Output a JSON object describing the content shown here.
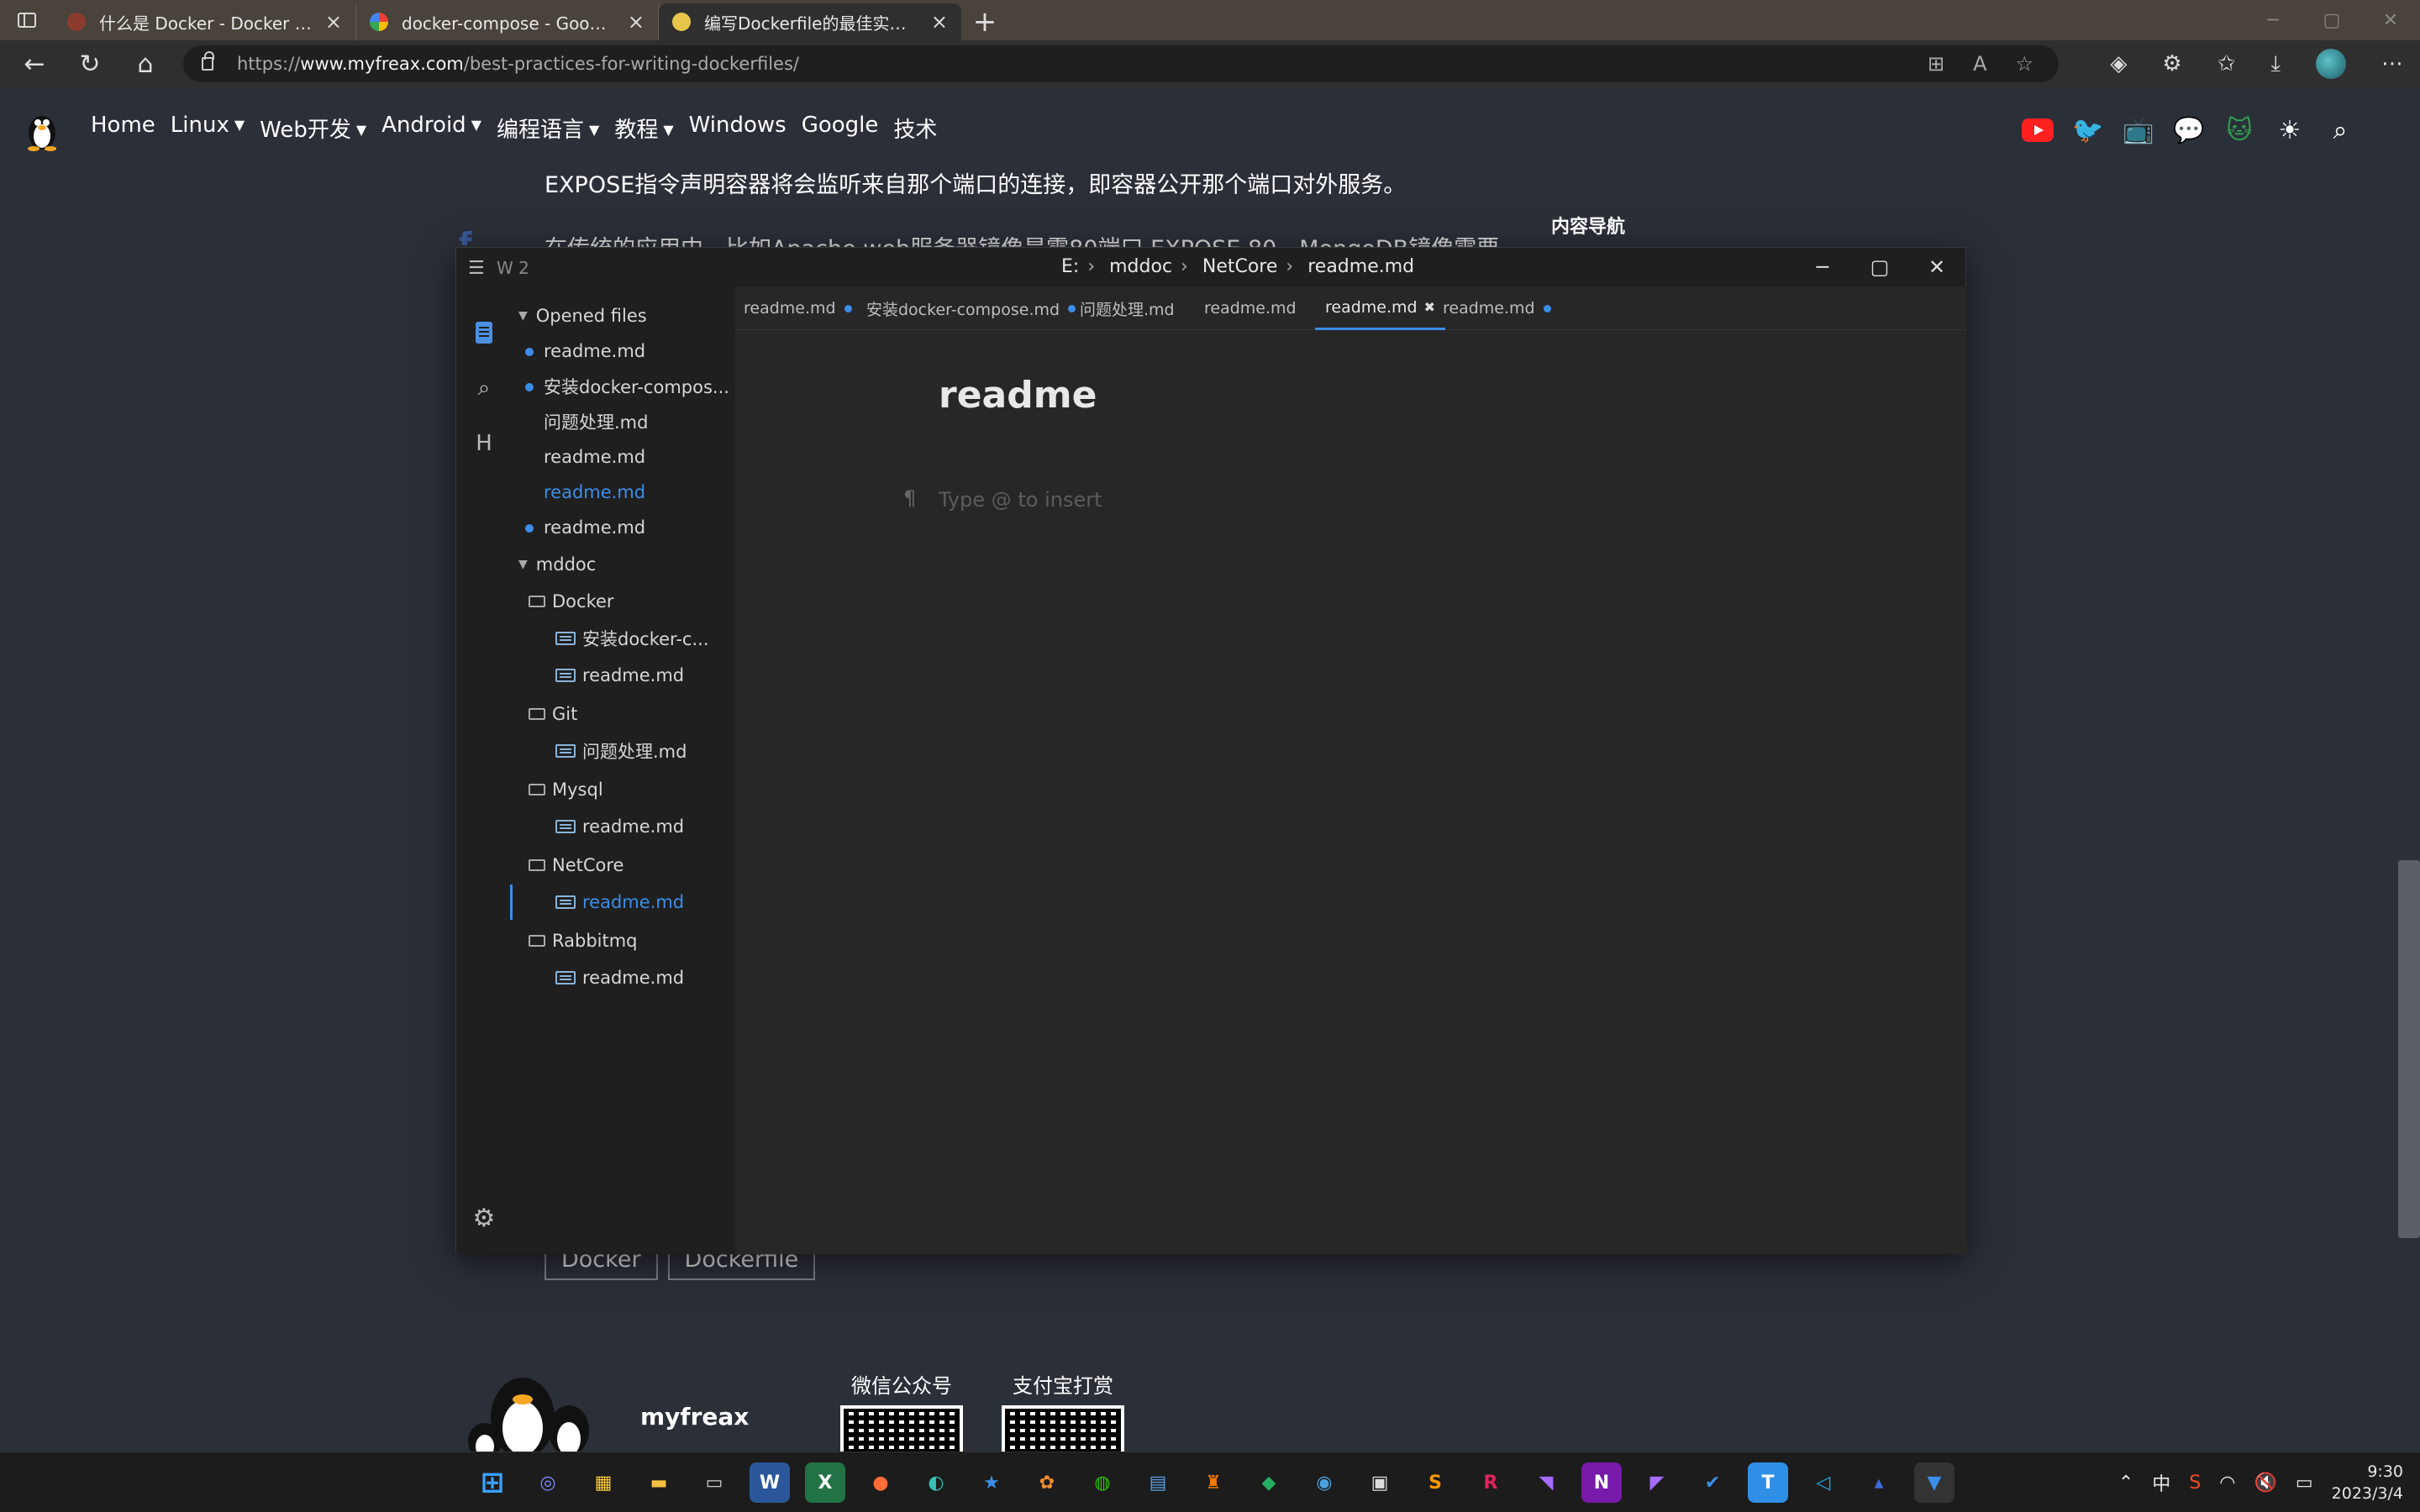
{
  "browser": {
    "tabs": [
      {
        "title": "什么是 Docker - Docker — 从入门",
        "favicon_color": "#c0392b"
      },
      {
        "title": "docker-compose - Google 搜索",
        "favicon_color": "#4285f4"
      },
      {
        "title": "编写Dockerfile的最佳实践 | myfreax",
        "favicon_color": "#e8c64a"
      }
    ],
    "new_tab_label": "+",
    "url_prefix": "https://",
    "url_domain": "www.myfreax.com",
    "url_path": "/best-practices-for-writing-dockerfiles/"
  },
  "site": {
    "nav": [
      {
        "label": "Home",
        "dropdown": false
      },
      {
        "label": "Linux",
        "dropdown": true
      },
      {
        "label": "Web开发",
        "dropdown": true
      },
      {
        "label": "Android",
        "dropdown": true
      },
      {
        "label": "编程语言",
        "dropdown": true
      },
      {
        "label": "教程",
        "dropdown": true
      },
      {
        "label": "Windows",
        "dropdown": false
      },
      {
        "label": "Google",
        "dropdown": false
      },
      {
        "label": "技术",
        "dropdown": false
      }
    ],
    "social_icons": [
      "youtube-icon",
      "twitter-icon",
      "bilibili-icon",
      "wechat-icon",
      "github-icon",
      "theme-toggle-icon",
      "search-icon"
    ],
    "article_line1": "EXPOSE指令声明容器将会监听来自那个端口的连接，即容器公开那个端口对外服务。",
    "article_line2": "在传统的应用中，比如Apache web服务器镜像是需80端口 EXPOSE 80，MongoDB镜像需要",
    "toc_title": "内容导航",
    "tags": [
      "Docker",
      "Dockerfile"
    ],
    "footer_brand": "myfreax",
    "qr_wechat_label": "微信公众号",
    "qr_alipay_label": "支付宝打赏"
  },
  "editor": {
    "workspace": "W 2",
    "path": [
      "E:",
      "mddoc",
      "NetCore",
      "readme.md"
    ],
    "opened_files_label": "Opened files",
    "opened_files": [
      {
        "name": "readme.md",
        "modified": true,
        "active": false
      },
      {
        "name": "安装docker-compos...",
        "modified": true,
        "active": false
      },
      {
        "name": "问题处理.md",
        "modified": false,
        "active": false
      },
      {
        "name": "readme.md",
        "modified": false,
        "active": false
      },
      {
        "name": "readme.md",
        "modified": false,
        "active": true
      },
      {
        "name": "readme.md",
        "modified": true,
        "active": false
      }
    ],
    "root_folder": "mddoc",
    "folders": [
      {
        "name": "Docker",
        "files": [
          "安装docker-c...",
          "readme.md"
        ]
      },
      {
        "name": "Git",
        "files": [
          "问题处理.md"
        ]
      },
      {
        "name": "Mysql",
        "files": [
          "readme.md"
        ]
      },
      {
        "name": "NetCore",
        "files": [
          "readme.md"
        ]
      },
      {
        "name": "Rabbitmq",
        "files": [
          "readme.md"
        ]
      }
    ],
    "tabs": [
      {
        "label": "readme.md",
        "modified": true
      },
      {
        "label": "安装docker-compose.md",
        "modified": true
      },
      {
        "label": "问题处理.md",
        "modified": false
      },
      {
        "label": "readme.md",
        "modified": false
      },
      {
        "label": "readme.md",
        "modified": false,
        "active": true
      },
      {
        "label": "readme.md",
        "modified": true
      }
    ],
    "doc_title": "readme",
    "placeholder": "Type @ to insert",
    "accent_color": "#3b8eea"
  },
  "taskbar": {
    "apps": [
      "windows-start",
      "cortana",
      "store",
      "file-explorer",
      "terminal",
      "word",
      "excel",
      "postman",
      "edge",
      "pin",
      "photos",
      "wechat",
      "notepad",
      "git-app",
      "sourcetree",
      "typora-app",
      "snipping",
      "sublime",
      "rider",
      "visual-studio",
      "onenote",
      "vs-preview",
      "todo",
      "teams",
      "vscode",
      "launcher",
      "mdeditor"
    ],
    "ime": "中",
    "time": "9:30",
    "date": "2023/3/4"
  }
}
